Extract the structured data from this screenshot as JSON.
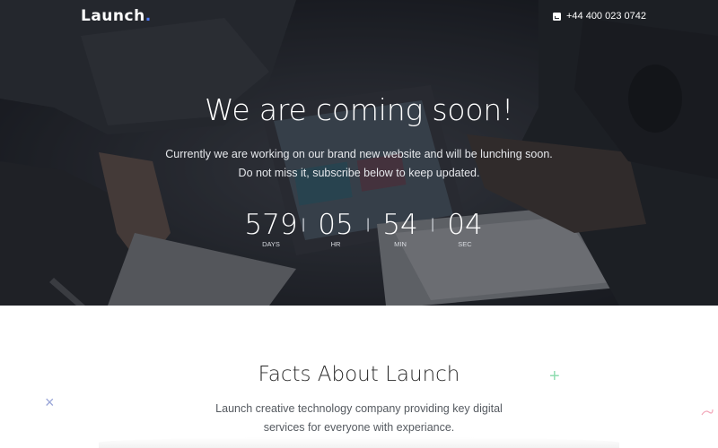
{
  "header": {
    "logo_text": "Launch",
    "logo_dot": ".",
    "phone": "+44 400 023 0742",
    "phone_icon": "phone-icon"
  },
  "hero": {
    "title": "We are coming soon!",
    "subtitle_line1": "Currently we are working on our brand new website and will be lunching soon.",
    "subtitle_line2": "Do not miss it, subscribe below to keep updated.",
    "countdown": [
      {
        "value": "579",
        "label": "DAYS"
      },
      {
        "value": "05",
        "label": "HR"
      },
      {
        "value": "54",
        "label": "MIN"
      },
      {
        "value": "04",
        "label": "SEC"
      }
    ],
    "separator": "|"
  },
  "facts": {
    "title": "Facts About Launch",
    "text_line1": "Launch creative technology company providing key digital",
    "text_line2": "services for everyone with experiance."
  },
  "colors": {
    "accent": "#4f7cff",
    "deco_green": "#8fdcb0",
    "deco_blue": "#9aa6d8",
    "deco_pink": "#f2a6b8"
  }
}
